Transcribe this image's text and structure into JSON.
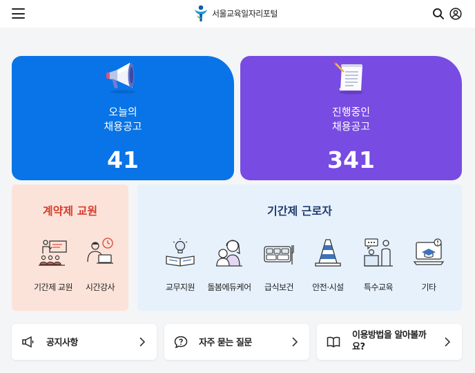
{
  "header": {
    "title": "서울교육일자리포털",
    "logo_icon": "seoul-education-logo",
    "menu_icon": "hamburger-menu-icon",
    "search_icon": "search-icon",
    "user_icon": "user-icon"
  },
  "cards": {
    "today": {
      "label_line1": "오늘의",
      "label_line2": "채용공고",
      "count": "41",
      "icon": "megaphone-icon",
      "color": "#0874e7"
    },
    "ongoing": {
      "label_line1": "진행중인",
      "label_line2": "채용공고",
      "count": "341",
      "icon": "document-scroll-icon",
      "color": "#784be2"
    }
  },
  "contract_teacher": {
    "title": "계약제 교원",
    "items": [
      {
        "label": "기간제 교원",
        "icon": "classroom-teacher-icon"
      },
      {
        "label": "시간강사",
        "icon": "instructor-clock-icon"
      }
    ]
  },
  "part_time_worker": {
    "title": "기간제 근로자",
    "items": [
      {
        "label": "교무지원",
        "icon": "book-lightbulb-icon"
      },
      {
        "label": "돌봄에듀케어",
        "icon": "caregiver-child-icon"
      },
      {
        "label": "급식보건",
        "icon": "meal-tray-icon"
      },
      {
        "label": "안전·시설",
        "icon": "traffic-cone-icon"
      },
      {
        "label": "특수교육",
        "icon": "special-education-icon"
      },
      {
        "label": "기타",
        "icon": "laptop-graduation-icon"
      }
    ]
  },
  "quick_links": [
    {
      "label": "공지사항",
      "icon": "megaphone-outline-icon"
    },
    {
      "label": "자주 묻는 질문",
      "icon": "question-bubble-icon"
    },
    {
      "label": "이용방법을 알아볼까요?",
      "icon": "open-book-icon"
    }
  ]
}
